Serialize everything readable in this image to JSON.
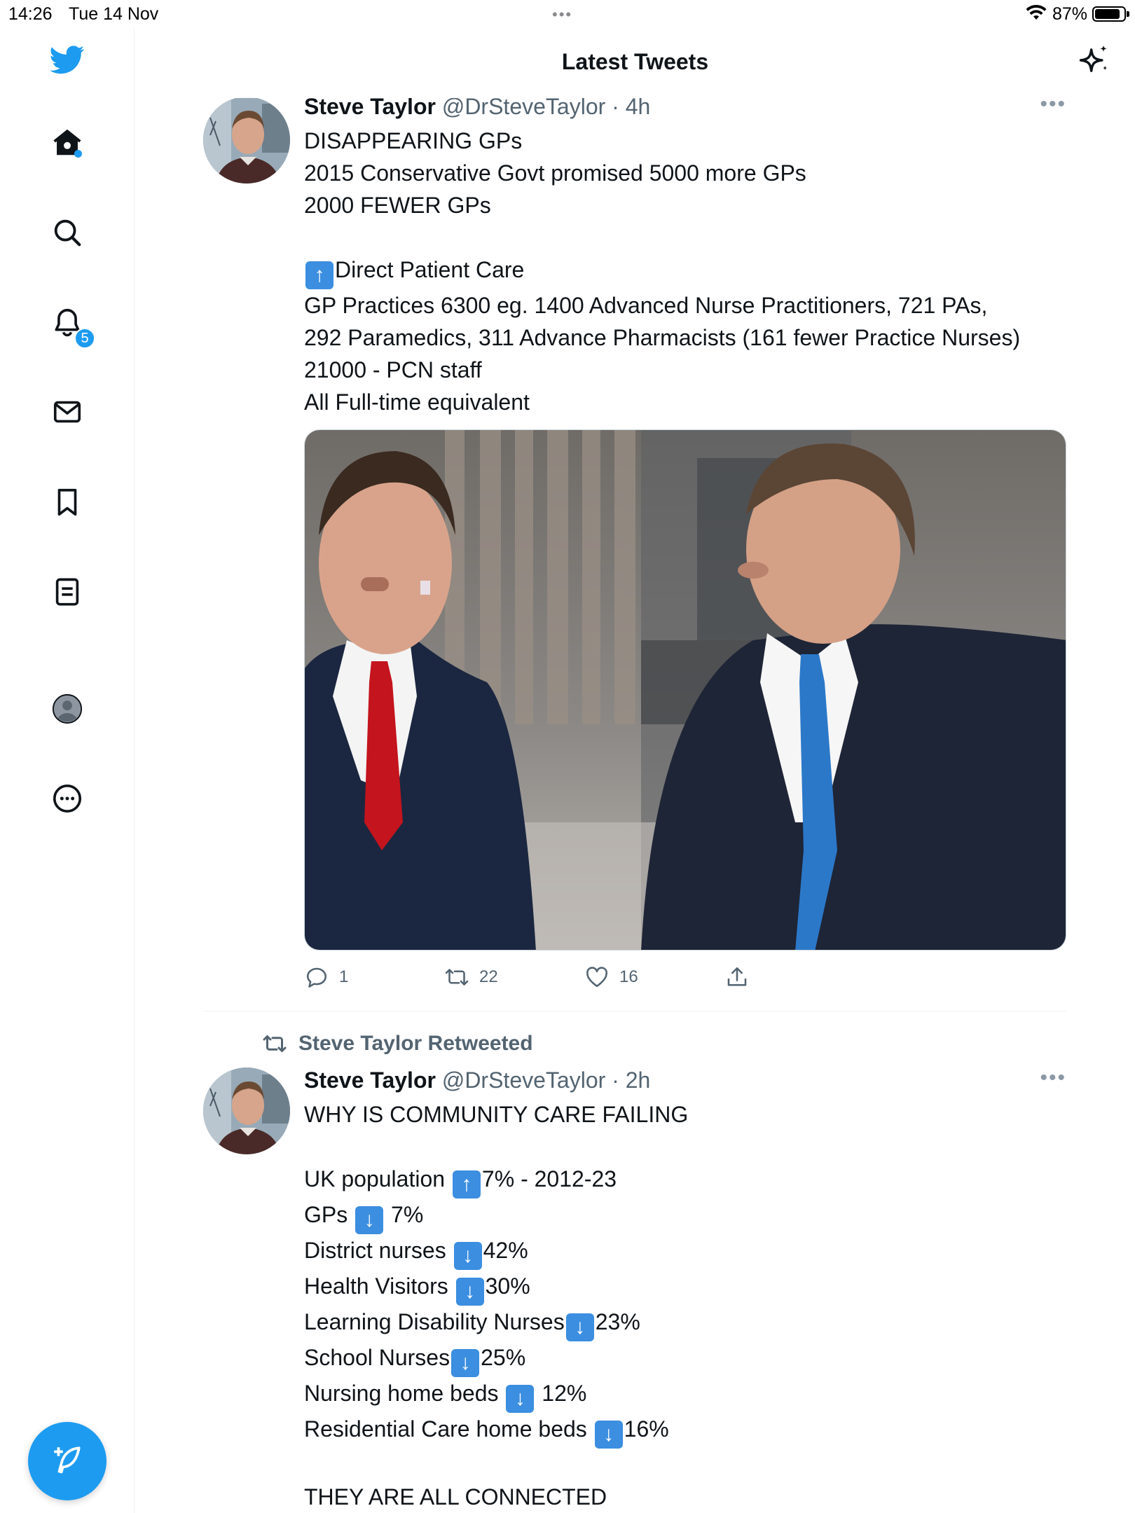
{
  "status_bar": {
    "time": "14:26",
    "date": "Tue 14 Nov",
    "battery": "87%",
    "battery_level": 0.87
  },
  "sidebar": {
    "notifications_badge": "5"
  },
  "header": {
    "title": "Latest Tweets"
  },
  "tweets": [
    {
      "name": "Steve Taylor",
      "handle": "@DrSteveTaylor",
      "time": "· 4h",
      "lines": [
        {
          "text": "DISAPPEARING GPs"
        },
        {
          "text": "2015 Conservative Govt promised 5000 more GPs"
        },
        {
          "text": "2000 FEWER GPs"
        },
        {
          "text": ""
        },
        {
          "emoji": "⬆",
          "text": "Direct Patient Care"
        },
        {
          "text": "GP Practices 6300 eg. 1400 Advanced Nurse Practitioners, 721 PAs,"
        },
        {
          "text": "292 Paramedics, 311 Advance Pharmacists (161 fewer Practice Nurses)"
        },
        {
          "text": "21000 - PCN staff"
        },
        {
          "text": "All Full-time equivalent"
        }
      ],
      "replies": "1",
      "retweets": "22",
      "likes": "16"
    },
    {
      "context": "Steve Taylor Retweeted",
      "name": "Steve Taylor",
      "handle": "@DrSteveTaylor",
      "time": "· 2h",
      "lines": [
        {
          "text": "WHY IS COMMUNITY CARE FAILING"
        },
        {
          "text": ""
        },
        {
          "pre": "UK population ",
          "emoji": "⬆",
          "text": "7% - 2012-23"
        },
        {
          "pre": "GPs ",
          "emoji": "⬇",
          "text": " 7%"
        },
        {
          "pre": "District nurses ",
          "emoji": "⬇",
          "text": "42%"
        },
        {
          "pre": "Health Visitors ",
          "emoji": "⬇",
          "text": "30%"
        },
        {
          "pre": "Learning Disability Nurses",
          "emoji": "⬇",
          "text": "23%"
        },
        {
          "pre": "School Nurses",
          "emoji": "⬇",
          "text": "25%"
        },
        {
          "pre": "Nursing home beds ",
          "emoji": "⬇",
          "text": " 12%"
        },
        {
          "pre": "Residential Care home beds ",
          "emoji": "⬇",
          "text": "16%"
        },
        {
          "text": ""
        },
        {
          "text": "THEY ARE ALL CONNECTED"
        }
      ]
    }
  ]
}
